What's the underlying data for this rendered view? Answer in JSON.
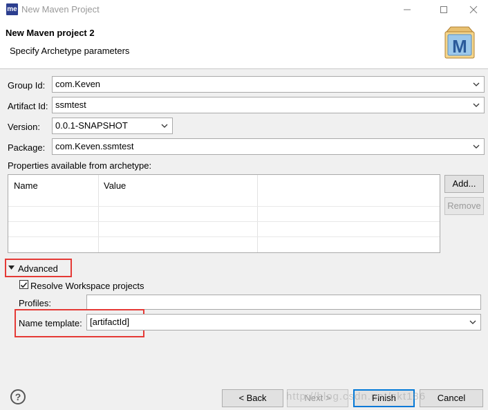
{
  "window": {
    "app_icon_text": "me",
    "title": "New Maven Project"
  },
  "header": {
    "title": "New Maven project 2",
    "subtitle": "Specify Archetype parameters",
    "logo_letter": "M"
  },
  "form": {
    "group_id_label": "Group Id:",
    "group_id_value": "com.Keven",
    "artifact_id_label": "Artifact Id:",
    "artifact_id_value": "ssmtest",
    "version_label": "Version:",
    "version_value": "0.0.1-SNAPSHOT",
    "package_label": "Package:",
    "package_value": "com.Keven.ssmtest",
    "properties_label": "Properties available from archetype:"
  },
  "properties_table": {
    "columns": [
      "Name",
      "Value"
    ],
    "rows": []
  },
  "table_buttons": {
    "add": "Add...",
    "remove": "Remove"
  },
  "advanced": {
    "label": "Advanced",
    "expanded": true,
    "resolve_workspace_label": "Resolve Workspace projects",
    "resolve_workspace_checked": true,
    "profiles_label": "Profiles:",
    "profiles_value": "",
    "name_template_label": "Name template:",
    "name_template_value": "[artifactId]"
  },
  "footer": {
    "back": "< Back",
    "next": "Next >",
    "finish": "Finish",
    "cancel": "Cancel",
    "watermark": "http://blog.csdn.net/zkt186"
  },
  "colors": {
    "highlight_box": "#e53935",
    "default_button_border": "#0078d7"
  }
}
